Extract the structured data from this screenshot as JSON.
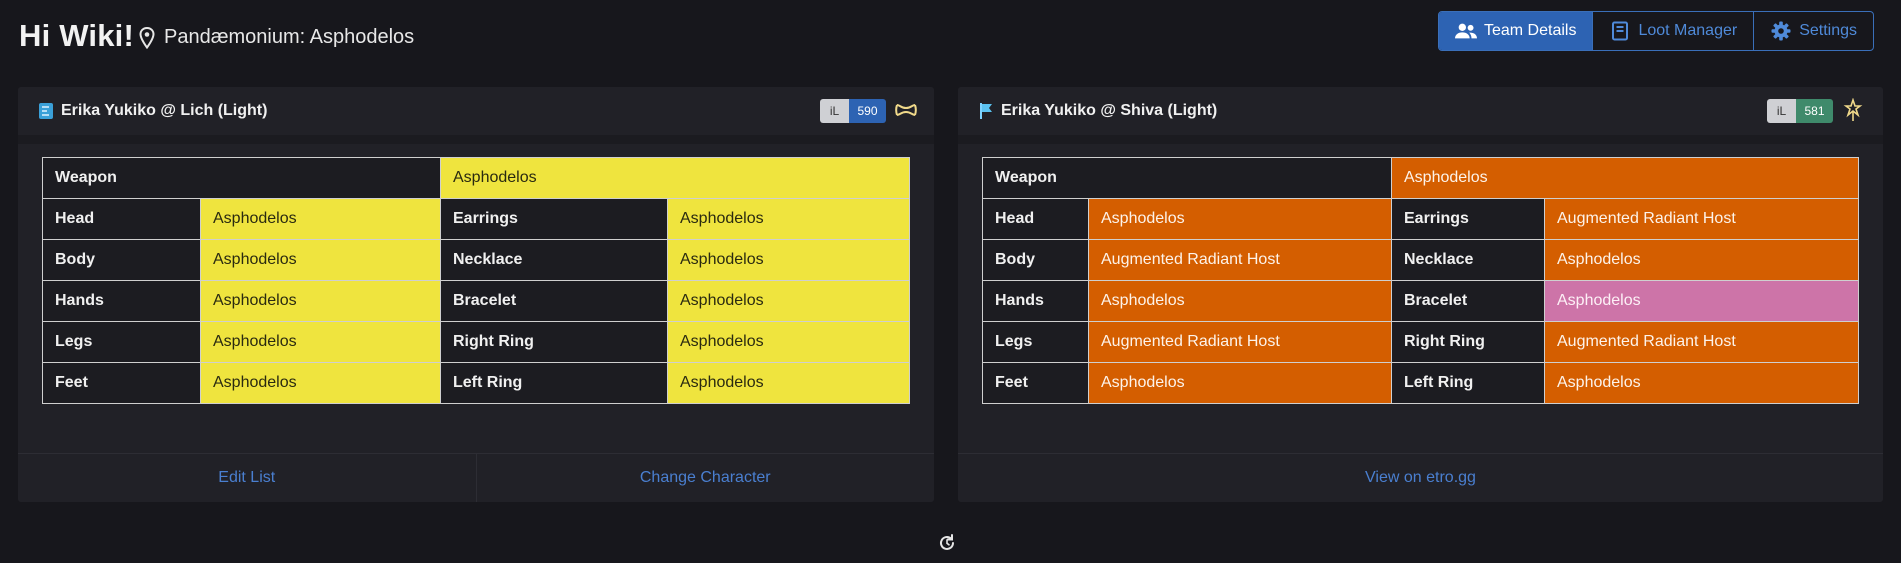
{
  "header": {
    "greeting": "Hi Wiki!",
    "team_name": "Pandæmonium: Asphodelos",
    "nav": [
      {
        "label": "Team Details",
        "icon": "users-icon",
        "active": true
      },
      {
        "label": "Loot Manager",
        "icon": "book-icon",
        "active": false
      },
      {
        "label": "Settings",
        "icon": "gear-icon",
        "active": false
      }
    ]
  },
  "cards": [
    {
      "title": "Erika Yukiko @ Lich (Light)",
      "job_icon": "scholar-job-icon",
      "il_label": "iL",
      "il_value": "590",
      "il_color": "#2d63b3",
      "role_icon": "healer-role-icon",
      "gear": {
        "weapon": {
          "label": "Weapon",
          "value": "Asphodelos"
        },
        "rows": [
          {
            "left_label": "Head",
            "left_value": "Asphodelos",
            "right_label": "Earrings",
            "right_value": "Asphodelos"
          },
          {
            "left_label": "Body",
            "left_value": "Asphodelos",
            "right_label": "Necklace",
            "right_value": "Asphodelos"
          },
          {
            "left_label": "Hands",
            "left_value": "Asphodelos",
            "right_label": "Bracelet",
            "right_value": "Asphodelos"
          },
          {
            "left_label": "Legs",
            "left_value": "Asphodelos",
            "right_label": "Right Ring",
            "right_value": "Asphodelos"
          },
          {
            "left_label": "Feet",
            "left_value": "Asphodelos",
            "right_label": "Left Ring",
            "right_value": "Asphodelos"
          }
        ]
      },
      "footer": [
        "Edit List",
        "Change Character"
      ]
    },
    {
      "title": "Erika Yukiko @ Shiva (Light)",
      "job_icon": "dancer-job-icon",
      "il_label": "iL",
      "il_value": "581",
      "il_color": "#3f8a6b",
      "role_icon": "ranged-dps-role-icon",
      "gear": {
        "weapon": {
          "label": "Weapon",
          "value": "Asphodelos"
        },
        "rows": [
          {
            "left_label": "Head",
            "left_value": "Asphodelos",
            "right_label": "Earrings",
            "right_value": "Augmented Radiant Host"
          },
          {
            "left_label": "Body",
            "left_value": "Augmented Radiant Host",
            "right_label": "Necklace",
            "right_value": "Asphodelos"
          },
          {
            "left_label": "Hands",
            "left_value": "Asphodelos",
            "right_label": "Bracelet",
            "right_value": "Asphodelos"
          },
          {
            "left_label": "Legs",
            "left_value": "Augmented Radiant Host",
            "right_label": "Right Ring",
            "right_value": "Augmented Radiant Host"
          },
          {
            "left_label": "Feet",
            "left_value": "Asphodelos",
            "right_label": "Left Ring",
            "right_value": "Asphodelos"
          }
        ]
      },
      "footer": [
        "View on etro.gg"
      ]
    }
  ],
  "colors": {
    "accent": "#2d63b3",
    "yellow_cell": "#efe43e",
    "orange_cell": "#d45e00",
    "pink_cell": "#cd74a8"
  },
  "bottom_icon": "refresh-icon"
}
